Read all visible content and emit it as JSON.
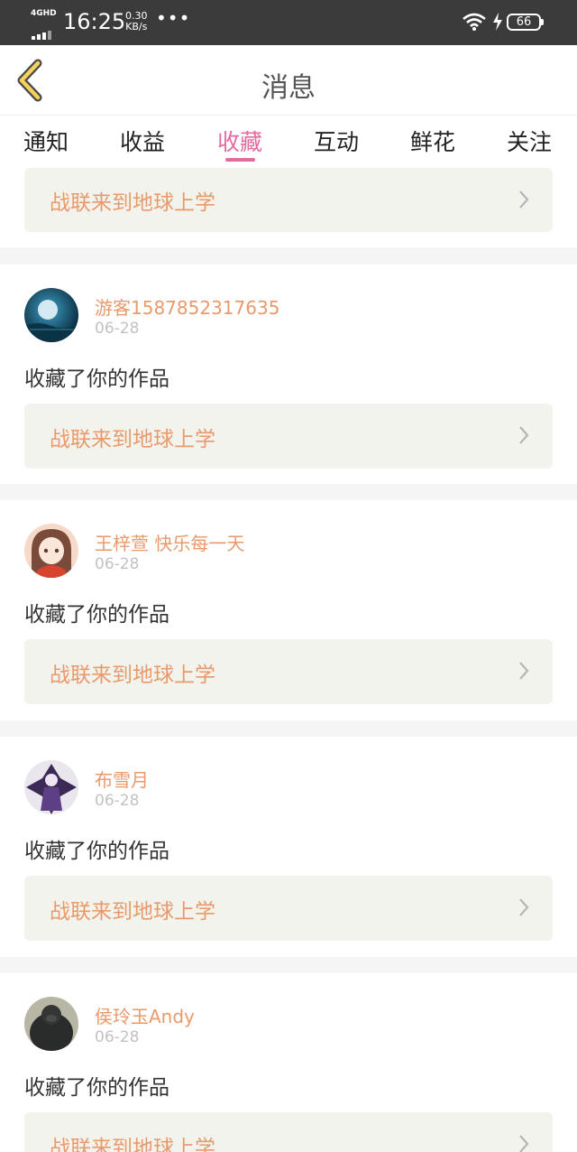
{
  "status_bar": {
    "network": "4GHD",
    "time": "16:25",
    "speed_value": "0.30",
    "speed_unit": "KB/s",
    "dots": "•••",
    "battery": "66"
  },
  "header": {
    "title": "消息"
  },
  "tabs": [
    {
      "label": "通知",
      "active": false
    },
    {
      "label": "收益",
      "active": false
    },
    {
      "label": "收藏",
      "active": true
    },
    {
      "label": "互动",
      "active": false
    },
    {
      "label": "鲜花",
      "active": false
    },
    {
      "label": "关注",
      "active": false
    }
  ],
  "colors": {
    "accent": "#e46ba0",
    "username": "#e89a6c",
    "link_bg": "#f3f3ed"
  },
  "feed": {
    "top_partial": {
      "work_title": "战联来到地球上学"
    },
    "items": [
      {
        "username": "游客1587852317635",
        "date": "06-28",
        "action": "收藏了你的作品",
        "work_title": "战联来到地球上学",
        "avatar": "moon-night-avatar"
      },
      {
        "username": "王梓萱 快乐每一天",
        "date": "06-28",
        "action": "收藏了你的作品",
        "work_title": "战联来到地球上学",
        "avatar": "anime-girl-avatar"
      },
      {
        "username": "布雪月",
        "date": "06-28",
        "action": "收藏了你的作品",
        "work_title": "战联来到地球上学",
        "avatar": "dark-anime-avatar"
      },
      {
        "username": "侯玲玉Andy",
        "date": "06-28",
        "action": "收藏了你的作品",
        "work_title": "战联来到地球上学",
        "avatar": "gorilla-avatar"
      }
    ]
  }
}
